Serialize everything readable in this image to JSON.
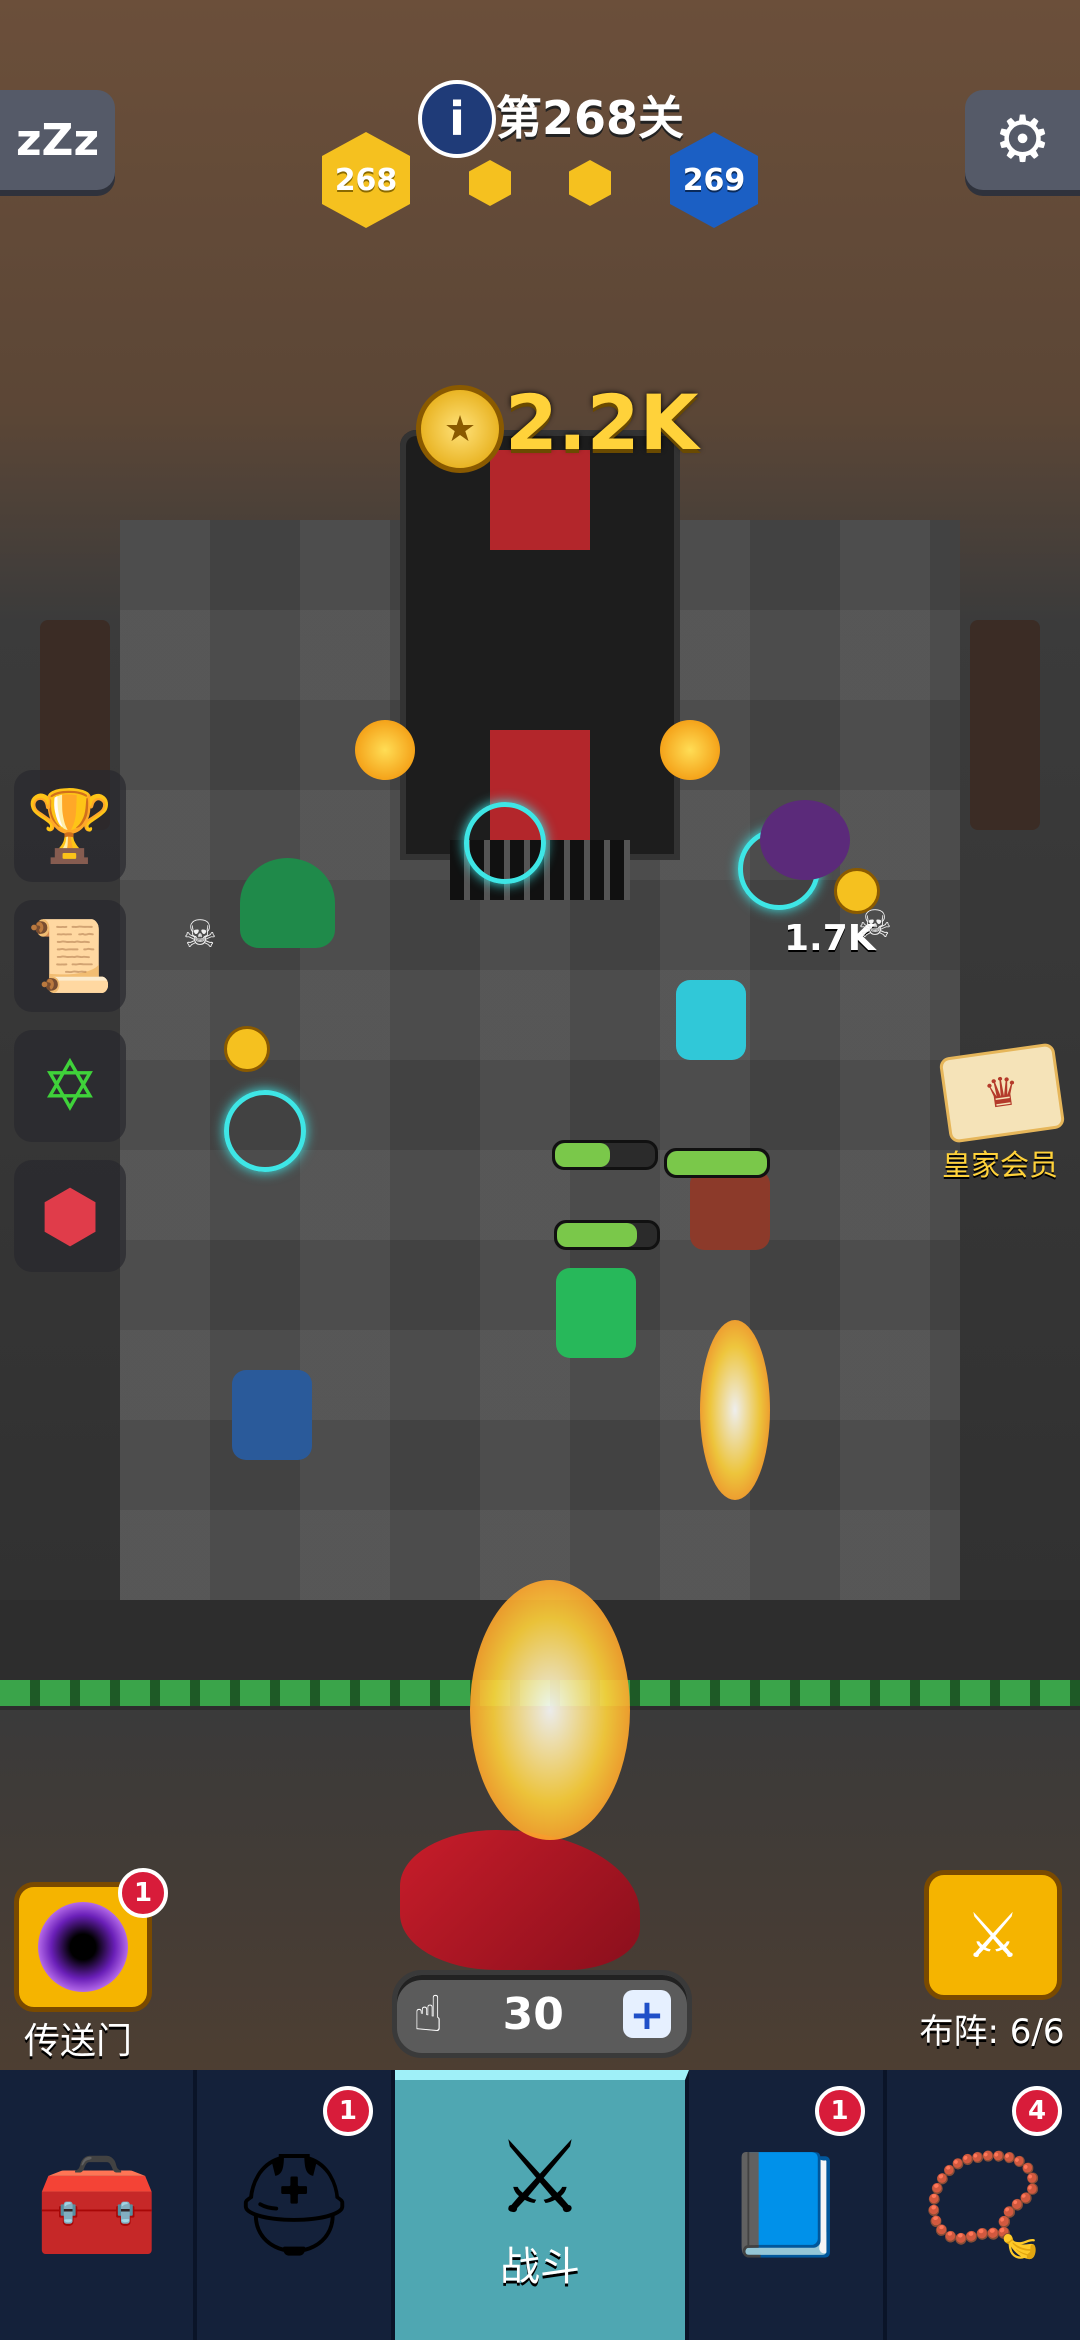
{
  "hud": {
    "rest_icon": "zzz-icon",
    "rest_label": "zZz",
    "settings_icon": "gear-icon",
    "level_title": "第268关",
    "current_level": "268",
    "next_level": "269"
  },
  "gold": {
    "amount": "2.2K"
  },
  "board": {
    "damage_text": "1.7K"
  },
  "royal": {
    "label": "皇家会员"
  },
  "portal": {
    "label": "传送门",
    "badge": "1"
  },
  "formation": {
    "label": "布阵: 6/6"
  },
  "tap": {
    "count": "30",
    "add_label": "+"
  },
  "nav": {
    "tabs": [
      {
        "icon": "treasure-chest-icon",
        "glyph": "🧰",
        "label": "",
        "badge": ""
      },
      {
        "icon": "viking-helmet-icon",
        "glyph": "⛑",
        "label": "",
        "badge": "1"
      },
      {
        "icon": "crossed-swords-icon",
        "glyph": "⚔",
        "label": "战斗",
        "badge": ""
      },
      {
        "icon": "spell-book-icon",
        "glyph": "📘",
        "label": "",
        "badge": "1"
      },
      {
        "icon": "amulet-necklace-icon",
        "glyph": "📿",
        "label": "",
        "badge": "4"
      }
    ]
  }
}
